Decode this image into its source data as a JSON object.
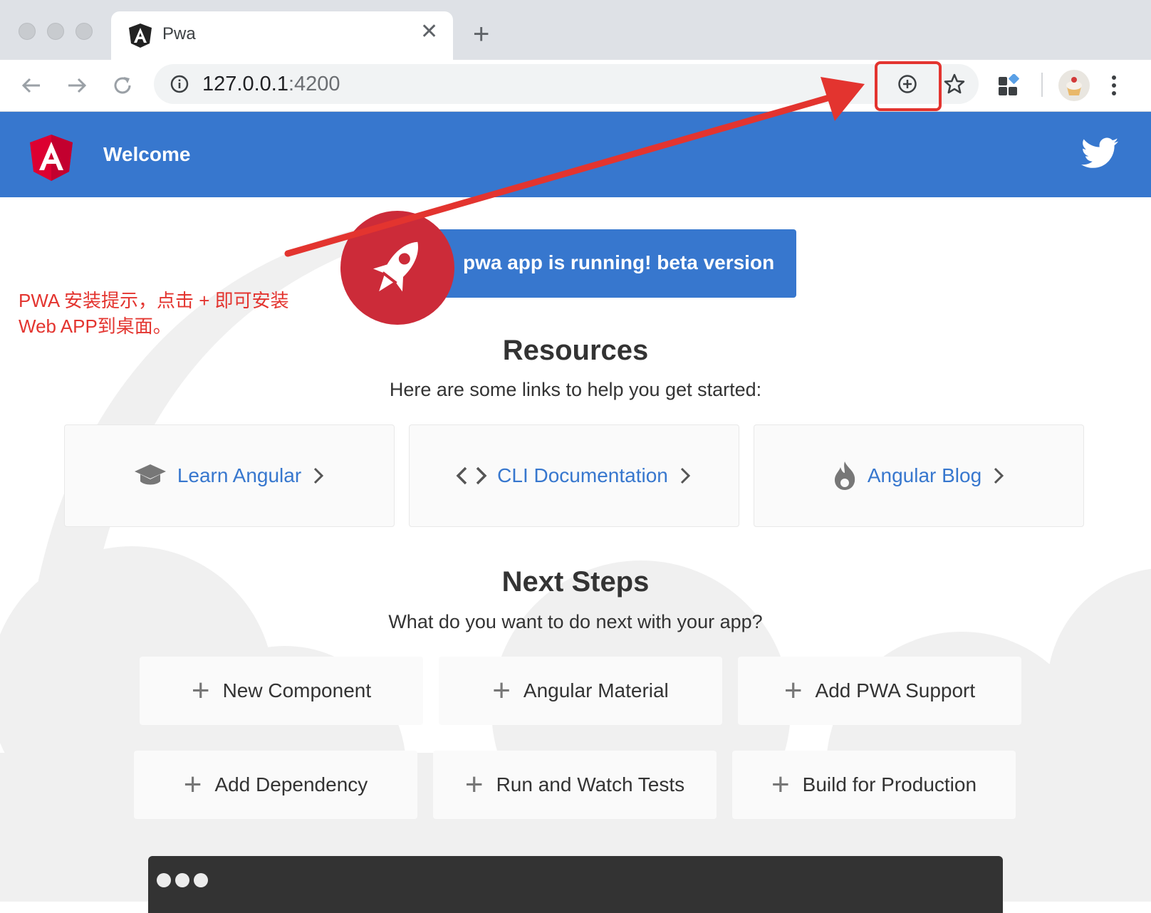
{
  "browser": {
    "tab_title": "Pwa",
    "tab_close": "✕",
    "new_tab": "+",
    "url_host": "127.0.0.1",
    "url_port": ":4200"
  },
  "header": {
    "title": "Welcome"
  },
  "banner": {
    "text": "pwa app is running! beta version"
  },
  "resources": {
    "title": "Resources",
    "subtitle": "Here are some links to help you get started:",
    "cards": [
      {
        "label": "Learn Angular",
        "icon": "graduation-cap-icon"
      },
      {
        "label": "CLI Documentation",
        "icon": "code-brackets-icon"
      },
      {
        "label": "Angular Blog",
        "icon": "flame-icon"
      }
    ]
  },
  "next_steps": {
    "title": "Next Steps",
    "subtitle": "What do you want to do next with your app?",
    "cards": [
      {
        "label": "New Component"
      },
      {
        "label": "Angular Material"
      },
      {
        "label": "Add PWA Support"
      },
      {
        "label": "Add Dependency"
      },
      {
        "label": "Run and Watch Tests"
      },
      {
        "label": "Build for Production"
      }
    ],
    "plus": "+"
  },
  "annotation": {
    "line1": "PWA 安装提示，点击 + 即可安装",
    "line2": "Web APP到桌面。"
  },
  "colors": {
    "header": "#3777ce",
    "rocket": "#cc2b39",
    "annotation": "#e3342f"
  }
}
